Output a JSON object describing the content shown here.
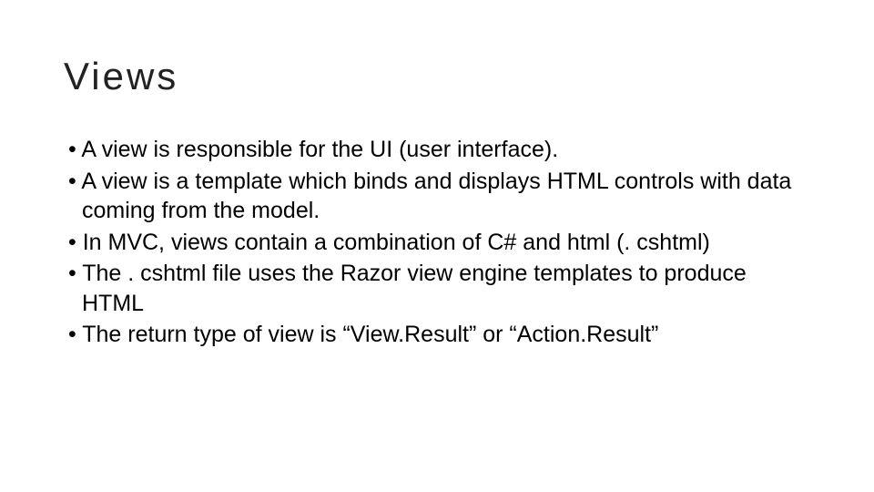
{
  "slide": {
    "title": "Views",
    "bullets": [
      "A view is responsible for the UI (user interface).",
      "A view is a template which binds and displays HTML controls with data coming from the model.",
      "In MVC, views contain a combination of C# and html (. cshtml)",
      "The . cshtml file uses the Razor view engine templates to produce HTML",
      "The return type of view is “View.Result” or “Action.Result”"
    ]
  }
}
